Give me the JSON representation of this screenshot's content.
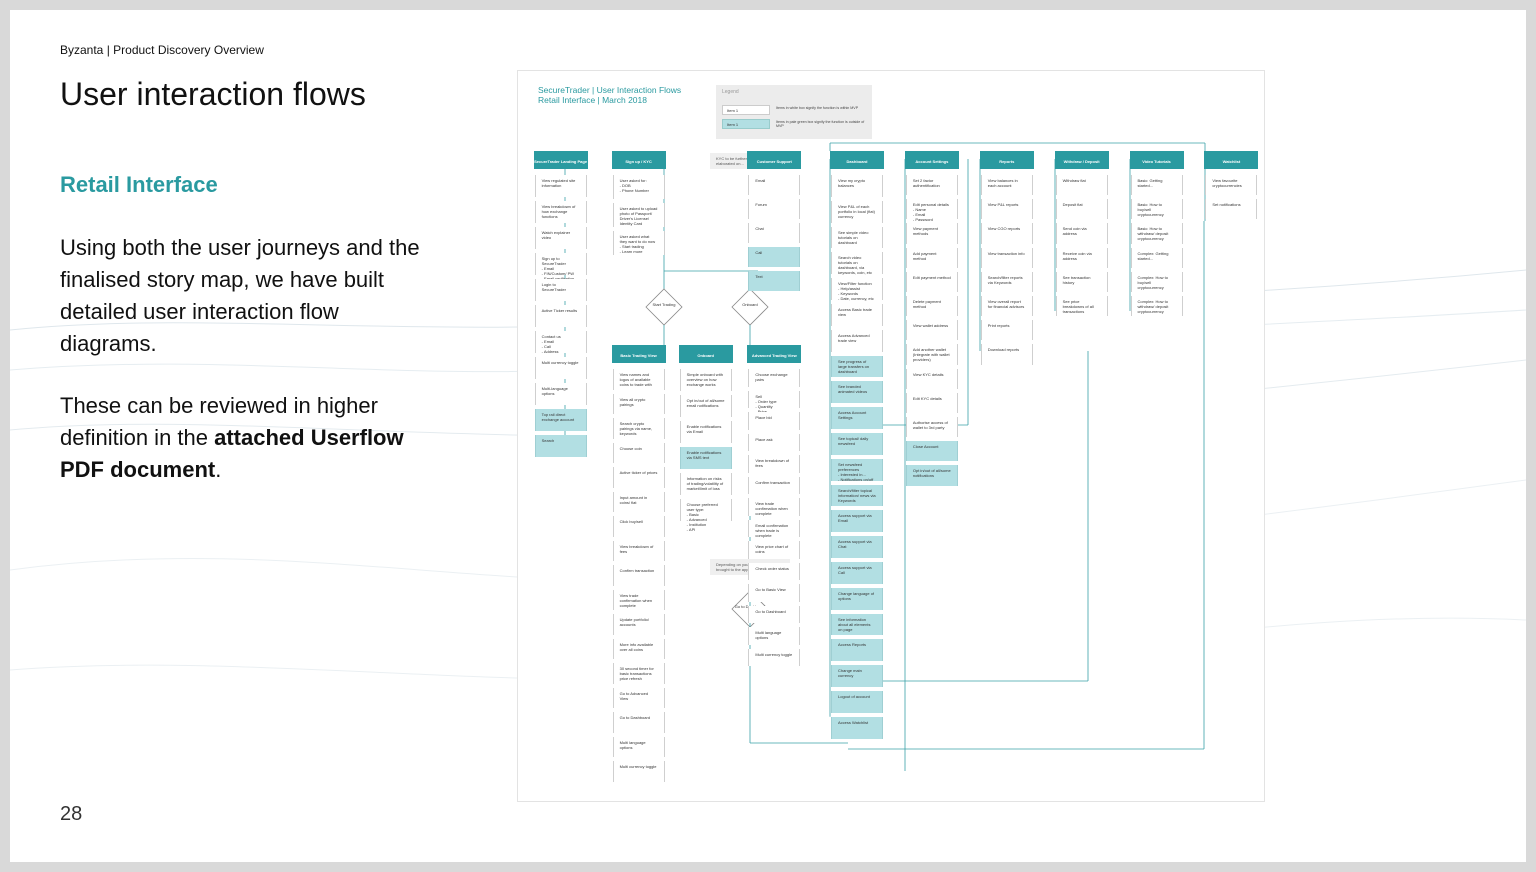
{
  "header": {
    "brand": "Byzanta",
    "breadcrumb_title": "Product Discovery Overview"
  },
  "title": "User interaction flows",
  "subtitle": "Retail Interface",
  "paragraph1": "Using both the user journeys and the finalised story map, we have built detailed user interaction flow diagrams.",
  "paragraph2_prefix": "These can be reviewed in higher definition in the ",
  "paragraph2_bold": "attached Userflow PDF document",
  "paragraph2_suffix": ".",
  "page_number": "28",
  "diagram": {
    "title_line1": "SecureTrader | User Interaction Flows",
    "title_line2": "Retail Interface | March 2018",
    "legend": {
      "heading": "Legend",
      "item1": "Item 1",
      "item1_desc": "Items in white box signify the function is within MVP",
      "item2": "Item 1",
      "item2_desc": "Items in pale green box signify the function is outside of MVP"
    },
    "columns": [
      {
        "header": "SecureTrader Landing Page",
        "nodes": [
          {
            "text": "View regulated site information"
          },
          {
            "text": "View breakdown of how exchange functions"
          },
          {
            "text": "Watch explainer video"
          },
          {
            "text": "Sign up to SecureTrader\n- Email\n- FIN/Custom/ PW\n- Email verification\n- Finish / KYC/AML Compliance"
          },
          {
            "text": "Login to SecureTrader"
          },
          {
            "text": "Active Ticker results"
          },
          {
            "text": "Contact us\n- Email\n- Call\n- Address"
          },
          {
            "text": "Multi currency toggle"
          },
          {
            "text": "Multi-language options"
          },
          {
            "text": "Top rail direct exchange account",
            "teal": true
          },
          {
            "text": "Search",
            "teal": true
          }
        ]
      },
      {
        "header": "Sign up / KYC",
        "nodes": [
          {
            "text": "User asked for:\n- DOB\n- Phone Number"
          },
          {
            "text": "User asked to upload photo of Passport/ Driver's License/ Identity Card"
          },
          {
            "text": "User asked what they want to do now\n- Start trading\n- Learn more"
          }
        ]
      },
      {
        "header": "Basic Trading View",
        "nodes": [
          {
            "text": "View names and logos of available coins to trade with"
          },
          {
            "text": "View all crypto pairings"
          },
          {
            "text": "Search crypto pairings via name, keywords"
          },
          {
            "text": "Choose coin"
          },
          {
            "text": "Active ticker of prices"
          },
          {
            "text": "Input amount in coins/ fiat"
          },
          {
            "text": "Click buy/sell"
          },
          {
            "text": "View breakdown of fees"
          },
          {
            "text": "Confirm transaction"
          },
          {
            "text": "View trade confirmation when complete"
          },
          {
            "text": "Update portfolio/ accounts"
          },
          {
            "text": "More info available over all coins"
          },
          {
            "text": "30 second timer for basic transactions price refresh"
          },
          {
            "text": "Go to Advanced View"
          },
          {
            "text": "Go to Dashboard"
          },
          {
            "text": "Multi language options"
          },
          {
            "text": "Multi currency toggle"
          }
        ]
      },
      {
        "header": "Onboard",
        "nodes": [
          {
            "text": "Simple onboard with overview on how exchange works"
          },
          {
            "text": "Opt in/out of all/some email notifications"
          },
          {
            "text": "Enable notifications via Email"
          },
          {
            "text": "Enable notifications via SMS text",
            "teal": true
          },
          {
            "text": "Information on risks of trading/volatility of market/limit of loss"
          },
          {
            "text": "Choose preferred user type:\n- Basic\n- Advanced\n- Institution\n- API"
          }
        ]
      },
      {
        "header": "Customer Support",
        "nodes": [
          {
            "text": "Email"
          },
          {
            "text": "Forum"
          },
          {
            "text": "Chat"
          },
          {
            "text": "Call",
            "teal": true
          },
          {
            "text": "Text",
            "teal": true
          }
        ]
      },
      {
        "header": "Advanced Trading View",
        "nodes": [
          {
            "text": "Choose exchange pairs"
          },
          {
            "text": "Sell\n- Order type\n- Quantity\n- Price"
          },
          {
            "text": "Place bid"
          },
          {
            "text": "Place ask"
          },
          {
            "text": "View breakdown of fees"
          },
          {
            "text": "Confirm transaction"
          },
          {
            "text": "View trade confirmation when complete"
          },
          {
            "text": "Email confirmation when trade is complete"
          },
          {
            "text": "View price chart of coins"
          },
          {
            "text": "Check order status"
          },
          {
            "text": "Go to Basic View"
          },
          {
            "text": "Go to Dashboard"
          },
          {
            "text": "Multi language options"
          },
          {
            "text": "Multi currency toggle"
          }
        ]
      },
      {
        "header": "Dashboard",
        "nodes": [
          {
            "text": "View my crypto balances"
          },
          {
            "text": "View P&L of each portfolio in local (fiat) currency"
          },
          {
            "text": "See simple video tutorials on dashboard"
          },
          {
            "text": "Search video tutorials on dashboard, via keywords, coin, etc"
          },
          {
            "text": "View/Filter function\n- Help/assist\n- Keywords\n- Date, currency, etc"
          },
          {
            "text": "Access Basic trade view"
          },
          {
            "text": "Access Advanced trade view"
          },
          {
            "text": "See progress of large transfers on dashboard",
            "teal": true
          },
          {
            "text": "See branded animated videos",
            "teal": true
          },
          {
            "text": "Access Account Settings",
            "teal": true
          },
          {
            "text": "See topical/ daily newsfeed",
            "teal": true
          },
          {
            "text": "Set newsfeed preferences\n- Interested in...\n- Notifications on/off",
            "teal": true
          },
          {
            "text": "Search/filter topical information/ news via Keywords",
            "teal": true
          },
          {
            "text": "Access support via Email",
            "teal": true
          },
          {
            "text": "Access support via Chat",
            "teal": true
          },
          {
            "text": "Access support via Call",
            "teal": true
          },
          {
            "text": "Change language of options",
            "teal": true
          },
          {
            "text": "See information about all elements on page",
            "teal": true
          },
          {
            "text": "Access Reports",
            "teal": true
          },
          {
            "text": "Change main currency",
            "teal": true
          },
          {
            "text": "Logout of account",
            "teal": true
          },
          {
            "text": "Access Watchlist",
            "teal": true
          }
        ]
      },
      {
        "header": "Account Settings",
        "nodes": [
          {
            "text": "Set 2 factor authentification"
          },
          {
            "text": "Edit personal details\n- Name\n- Email\n- Password\n- Phone number"
          },
          {
            "text": "View payment methods"
          },
          {
            "text": "Add payment method"
          },
          {
            "text": "Edit payment method"
          },
          {
            "text": "Delete payment method"
          },
          {
            "text": "View wallet address"
          },
          {
            "text": "Add another wallet (Integrate with wallet providers)"
          },
          {
            "text": "View KYC details"
          },
          {
            "text": "Edit KYC details"
          },
          {
            "text": "Authorise access of wallet to 3rd party"
          },
          {
            "text": "Close Account",
            "teal": true
          },
          {
            "text": "Opt in/out of all/some notifications",
            "teal": true
          }
        ]
      },
      {
        "header": "Reports",
        "nodes": [
          {
            "text": "View balances in each account"
          },
          {
            "text": "View P&L reports"
          },
          {
            "text": "View CGO reports"
          },
          {
            "text": "View transaction info"
          },
          {
            "text": "Search/filter reports via Keywords"
          },
          {
            "text": "View overall report for financial advisors"
          },
          {
            "text": "Print reports"
          },
          {
            "text": "Download reports"
          }
        ]
      },
      {
        "header": "Withdraw / Deposit",
        "nodes": [
          {
            "text": "Withdraw fiat"
          },
          {
            "text": "Deposit fiat"
          },
          {
            "text": "Send coin via address"
          },
          {
            "text": "Receive coin via address"
          },
          {
            "text": "See transaction history"
          },
          {
            "text": "See price breakdowns of all transactions"
          }
        ]
      },
      {
        "header": "Video Tutorials",
        "nodes": [
          {
            "text": "Basic: Getting started..."
          },
          {
            "text": "Basic: How to buy/sell cryptocurrency"
          },
          {
            "text": "Basic: How to withdraw/ deposit cryptocurrency"
          },
          {
            "text": "Complex: Getting started..."
          },
          {
            "text": "Complex: How to buy/sell cryptocurrency"
          },
          {
            "text": "Complex: How to withdraw/ deposit cryptocurrency"
          }
        ]
      },
      {
        "header": "Watchlist",
        "nodes": [
          {
            "text": "View favourite cryptocurrencies"
          },
          {
            "text": "Set notifications"
          }
        ]
      }
    ],
    "notes": {
      "kyc": "KYC to be further elaborated on...",
      "choice": "Depending on your choice, you are brought to the appropriate dashboard"
    },
    "diamonds": {
      "start_trading": "Start Trading",
      "onboard": "Onboard",
      "go_to_dashboard": "Go to Dashboard"
    }
  },
  "colors": {
    "accent": "#2a9aa0",
    "teal_light": "#b2dfe3"
  }
}
